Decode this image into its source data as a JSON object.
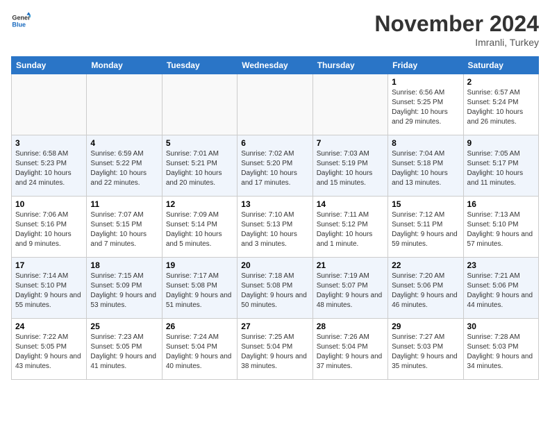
{
  "logo": {
    "general": "General",
    "blue": "Blue"
  },
  "title": "November 2024",
  "subtitle": "Imranli, Turkey",
  "headers": [
    "Sunday",
    "Monday",
    "Tuesday",
    "Wednesday",
    "Thursday",
    "Friday",
    "Saturday"
  ],
  "weeks": [
    [
      {
        "day": "",
        "info": ""
      },
      {
        "day": "",
        "info": ""
      },
      {
        "day": "",
        "info": ""
      },
      {
        "day": "",
        "info": ""
      },
      {
        "day": "",
        "info": ""
      },
      {
        "day": "1",
        "info": "Sunrise: 6:56 AM\nSunset: 5:25 PM\nDaylight: 10 hours and 29 minutes."
      },
      {
        "day": "2",
        "info": "Sunrise: 6:57 AM\nSunset: 5:24 PM\nDaylight: 10 hours and 26 minutes."
      }
    ],
    [
      {
        "day": "3",
        "info": "Sunrise: 6:58 AM\nSunset: 5:23 PM\nDaylight: 10 hours and 24 minutes."
      },
      {
        "day": "4",
        "info": "Sunrise: 6:59 AM\nSunset: 5:22 PM\nDaylight: 10 hours and 22 minutes."
      },
      {
        "day": "5",
        "info": "Sunrise: 7:01 AM\nSunset: 5:21 PM\nDaylight: 10 hours and 20 minutes."
      },
      {
        "day": "6",
        "info": "Sunrise: 7:02 AM\nSunset: 5:20 PM\nDaylight: 10 hours and 17 minutes."
      },
      {
        "day": "7",
        "info": "Sunrise: 7:03 AM\nSunset: 5:19 PM\nDaylight: 10 hours and 15 minutes."
      },
      {
        "day": "8",
        "info": "Sunrise: 7:04 AM\nSunset: 5:18 PM\nDaylight: 10 hours and 13 minutes."
      },
      {
        "day": "9",
        "info": "Sunrise: 7:05 AM\nSunset: 5:17 PM\nDaylight: 10 hours and 11 minutes."
      }
    ],
    [
      {
        "day": "10",
        "info": "Sunrise: 7:06 AM\nSunset: 5:16 PM\nDaylight: 10 hours and 9 minutes."
      },
      {
        "day": "11",
        "info": "Sunrise: 7:07 AM\nSunset: 5:15 PM\nDaylight: 10 hours and 7 minutes."
      },
      {
        "day": "12",
        "info": "Sunrise: 7:09 AM\nSunset: 5:14 PM\nDaylight: 10 hours and 5 minutes."
      },
      {
        "day": "13",
        "info": "Sunrise: 7:10 AM\nSunset: 5:13 PM\nDaylight: 10 hours and 3 minutes."
      },
      {
        "day": "14",
        "info": "Sunrise: 7:11 AM\nSunset: 5:12 PM\nDaylight: 10 hours and 1 minute."
      },
      {
        "day": "15",
        "info": "Sunrise: 7:12 AM\nSunset: 5:11 PM\nDaylight: 9 hours and 59 minutes."
      },
      {
        "day": "16",
        "info": "Sunrise: 7:13 AM\nSunset: 5:10 PM\nDaylight: 9 hours and 57 minutes."
      }
    ],
    [
      {
        "day": "17",
        "info": "Sunrise: 7:14 AM\nSunset: 5:10 PM\nDaylight: 9 hours and 55 minutes."
      },
      {
        "day": "18",
        "info": "Sunrise: 7:15 AM\nSunset: 5:09 PM\nDaylight: 9 hours and 53 minutes."
      },
      {
        "day": "19",
        "info": "Sunrise: 7:17 AM\nSunset: 5:08 PM\nDaylight: 9 hours and 51 minutes."
      },
      {
        "day": "20",
        "info": "Sunrise: 7:18 AM\nSunset: 5:08 PM\nDaylight: 9 hours and 50 minutes."
      },
      {
        "day": "21",
        "info": "Sunrise: 7:19 AM\nSunset: 5:07 PM\nDaylight: 9 hours and 48 minutes."
      },
      {
        "day": "22",
        "info": "Sunrise: 7:20 AM\nSunset: 5:06 PM\nDaylight: 9 hours and 46 minutes."
      },
      {
        "day": "23",
        "info": "Sunrise: 7:21 AM\nSunset: 5:06 PM\nDaylight: 9 hours and 44 minutes."
      }
    ],
    [
      {
        "day": "24",
        "info": "Sunrise: 7:22 AM\nSunset: 5:05 PM\nDaylight: 9 hours and 43 minutes."
      },
      {
        "day": "25",
        "info": "Sunrise: 7:23 AM\nSunset: 5:05 PM\nDaylight: 9 hours and 41 minutes."
      },
      {
        "day": "26",
        "info": "Sunrise: 7:24 AM\nSunset: 5:04 PM\nDaylight: 9 hours and 40 minutes."
      },
      {
        "day": "27",
        "info": "Sunrise: 7:25 AM\nSunset: 5:04 PM\nDaylight: 9 hours and 38 minutes."
      },
      {
        "day": "28",
        "info": "Sunrise: 7:26 AM\nSunset: 5:04 PM\nDaylight: 9 hours and 37 minutes."
      },
      {
        "day": "29",
        "info": "Sunrise: 7:27 AM\nSunset: 5:03 PM\nDaylight: 9 hours and 35 minutes."
      },
      {
        "day": "30",
        "info": "Sunrise: 7:28 AM\nSunset: 5:03 PM\nDaylight: 9 hours and 34 minutes."
      }
    ]
  ]
}
